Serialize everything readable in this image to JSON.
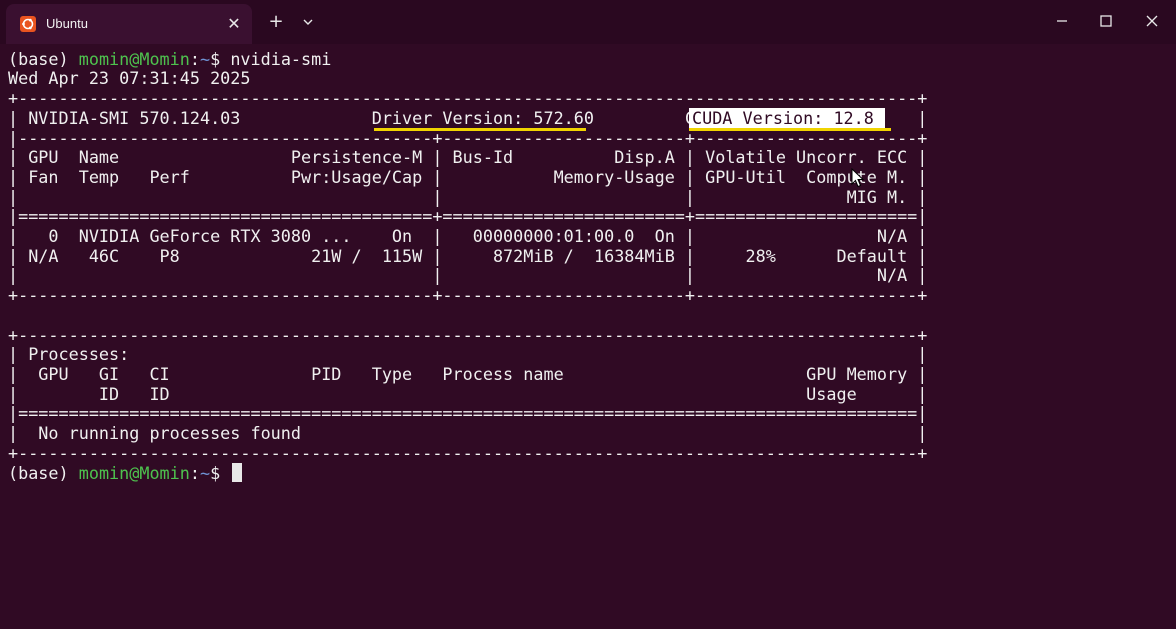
{
  "window": {
    "tab_title": "Ubuntu",
    "tab_close_glyph": "✕",
    "new_tab_glyph": "+",
    "icons": {
      "tab_icon": "ubuntu-logo-icon",
      "dropdown": "chevron-down-icon",
      "minimize": "minimize-icon",
      "maximize": "maximize-icon",
      "close": "close-icon"
    }
  },
  "terminal": {
    "prompt": {
      "env": "(base) ",
      "user_host": "momin@Momin",
      "colon": ":",
      "path": "~",
      "symbol": "$ "
    },
    "command": "nvidia-smi",
    "timestamp": "Wed Apr 23 07:31:45 2025",
    "output_lines": [
      "+-----------------------------------------------------------------------------------------+",
      "| NVIDIA-SMI 570.124.03             Driver Version: 572.60         CUDA Version: 12.8     |",
      "|-----------------------------------------+------------------------+----------------------+",
      "| GPU  Name                 Persistence-M | Bus-Id          Disp.A | Volatile Uncorr. ECC |",
      "| Fan  Temp   Perf          Pwr:Usage/Cap |           Memory-Usage | GPU-Util  Compute M. |",
      "|                                         |                        |               MIG M. |",
      "|=========================================+========================+======================|",
      "|   0  NVIDIA GeForce RTX 3080 ...    On  |   00000000:01:00.0  On |                  N/A |",
      "| N/A   46C    P8             21W /  115W |     872MiB /  16384MiB |     28%      Default |",
      "|                                         |                        |                  N/A |",
      "+-----------------------------------------+------------------------+----------------------+",
      "",
      "+-----------------------------------------------------------------------------------------+",
      "| Processes:                                                                              |",
      "|  GPU   GI   CI              PID   Type   Process name                        GPU Memory |",
      "|        ID   ID                                                               Usage      |",
      "|=========================================================================================|",
      "|  No running processes found                                                             |",
      "+-----------------------------------------------------------------------------------------+"
    ],
    "cuda_version_label": "CUDA Version: 12.8",
    "colors": {
      "background": "#300a24",
      "text": "#f0f0f0",
      "user": "#4ec24e",
      "path": "#6f94d6",
      "highlight_underline": "#f0d400",
      "selection": "#ffffff"
    }
  }
}
